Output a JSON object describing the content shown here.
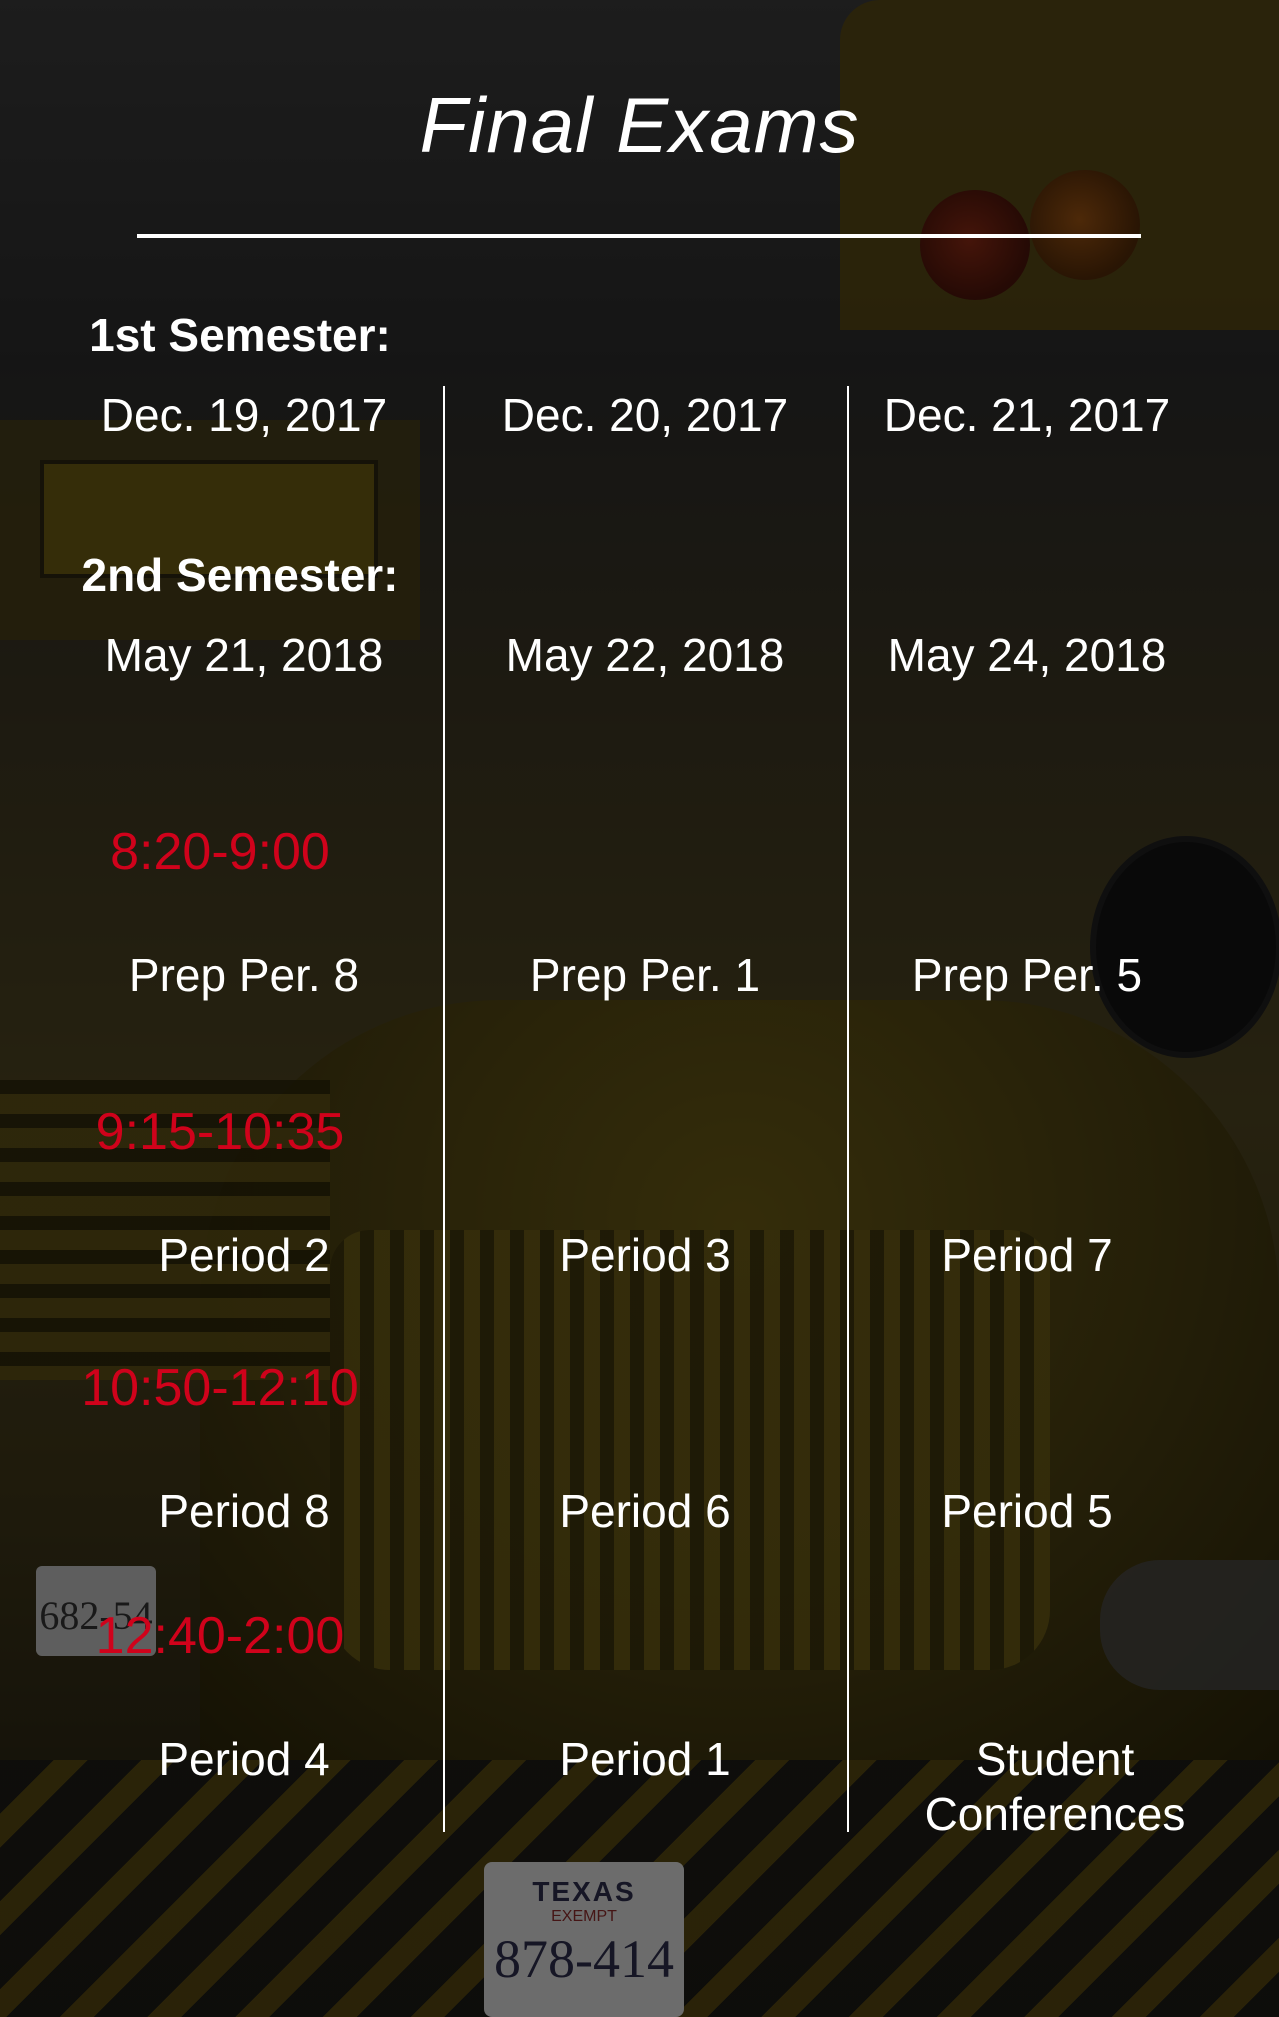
{
  "header": {
    "title": "Final Exams"
  },
  "semesters": [
    {
      "label": "1st Semester:",
      "dates": [
        "Dec. 19, 2017",
        "Dec. 20, 2017",
        "Dec. 21, 2017"
      ]
    },
    {
      "label": "2nd Semester:",
      "dates": [
        "May 21, 2018",
        "May 22, 2018",
        "May 24, 2018"
      ]
    }
  ],
  "schedule": [
    {
      "time": "8:20-9:00",
      "periods": [
        "Prep Per. 8",
        "Prep Per. 1",
        "Prep Per. 5"
      ]
    },
    {
      "time": "9:15-10:35",
      "periods": [
        "Period 2",
        "Period 3",
        "Period 7"
      ]
    },
    {
      "time": "10:50-12:10",
      "periods": [
        "Period 8",
        "Period 6",
        "Period 5"
      ]
    },
    {
      "time": "12:40-2:00",
      "periods": [
        "Period 4",
        "Period 1",
        "Student Conferences"
      ]
    }
  ],
  "background": {
    "plate_right": {
      "state": "TEXAS",
      "exempt": "EXEMPT",
      "number": "878-414"
    },
    "plate_left": {
      "number": "682-54"
    }
  },
  "colors": {
    "time_accent": "#d0021b",
    "text": "#ffffff",
    "overlay": "rgba(0,0,0,0.5)"
  }
}
